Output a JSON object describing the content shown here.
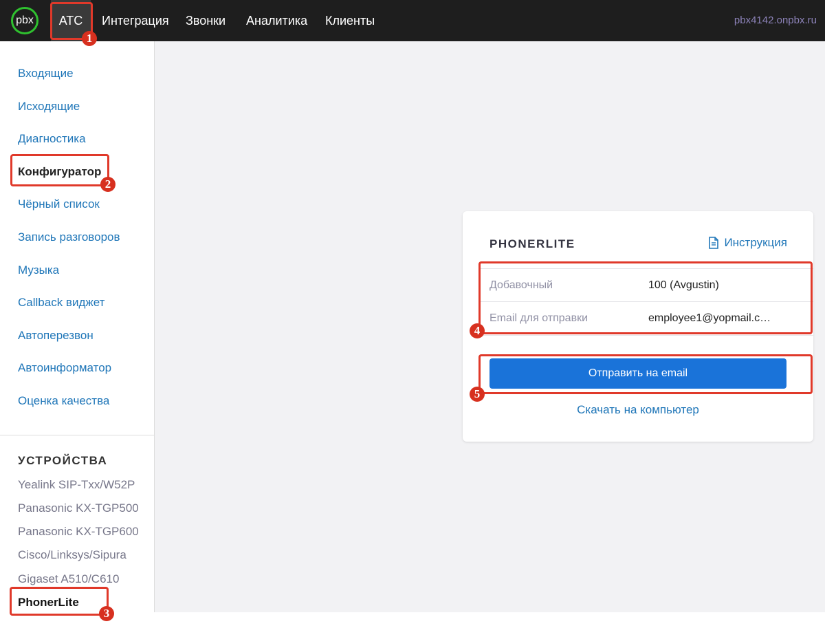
{
  "topbar": {
    "logo": "pbx",
    "nav": [
      "АТС",
      "Интеграция",
      "Звонки",
      "Аналитика",
      "Клиенты"
    ],
    "domain": "pbx4142.onpbx.ru"
  },
  "sidebar": {
    "items": [
      "Входящие",
      "Исходящие",
      "Диагностика",
      "Конфигуратор",
      "Чёрный список",
      "Запись разговоров",
      "Музыка",
      "Callback виджет",
      "Автоперезвон",
      "Автоинформатор",
      "Оценка качества"
    ],
    "active_item": "Конфигуратор",
    "devices_title": "УСТРОЙСТВА",
    "devices": [
      "Yealink SIP-Txx/W52P",
      "Panasonic KX-TGP500",
      "Panasonic KX-TGP600",
      "Cisco/Linksys/Sipura",
      "Gigaset A510/C610",
      "PhonerLite"
    ],
    "active_device": "PhonerLite"
  },
  "card": {
    "title": "PHONERLITE",
    "instruction_link": "Инструкция",
    "fields": [
      {
        "label": "Добавочный",
        "value": "100 (Avgustin)"
      },
      {
        "label": "Email для отправки",
        "value": "employee1@yopmail.c…"
      }
    ],
    "send_button": "Отправить на email",
    "download_link": "Скачать на компьютер"
  },
  "annotations": [
    "1",
    "2",
    "3",
    "4",
    "5"
  ],
  "colors": {
    "accent": "#1a73d9",
    "link": "#1f76b8",
    "annotation": "#e0392a",
    "logo_ring": "#2fc12f"
  }
}
